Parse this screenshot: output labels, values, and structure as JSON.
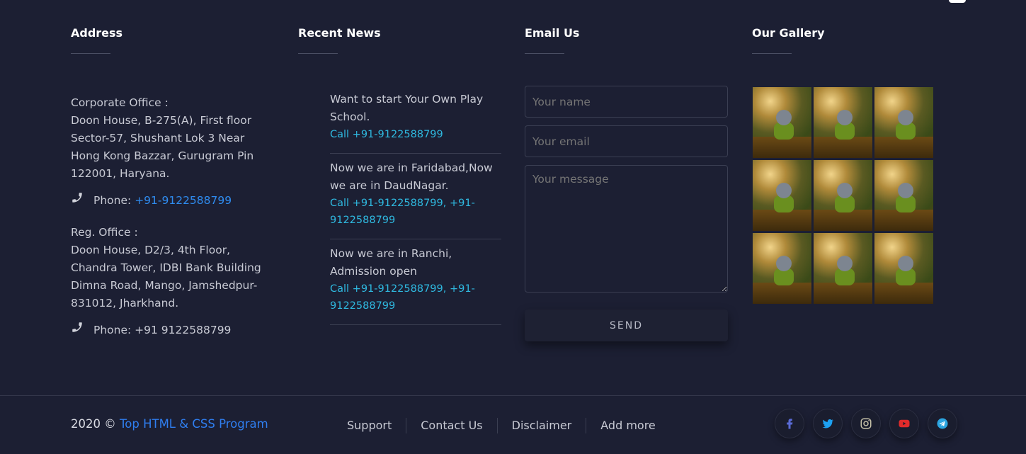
{
  "columns": {
    "address_title": "Address",
    "news_title": "Recent News",
    "email_title": "Email Us",
    "gallery_title": "Our Gallery"
  },
  "address": {
    "corporate_label": "Corporate Office :",
    "corporate_lines": [
      "Doon House, B-275(A), First floor",
      "Sector-57, Shushant Lok 3 Near",
      "Hong Kong Bazzar, Gurugram Pin",
      "122001, Haryana."
    ],
    "corporate_phone_label": "Phone:",
    "corporate_phone": "+91-9122588799",
    "reg_label": "Reg. Office :",
    "reg_lines": [
      "Doon House, D2/3, 4th Floor,",
      "Chandra Tower, IDBI Bank Building",
      "Dimna Road, Mango, Jamshedpur-",
      "831012, Jharkhand."
    ],
    "reg_phone_text": "Phone: +91 9122588799"
  },
  "news": [
    {
      "text": "Want to start Your Own Play School.",
      "call": "Call +91-9122588799"
    },
    {
      "text": "Now we are in Faridabad,Now we are in DaudNagar.",
      "call": "Call +91-9122588799, +91-9122588799"
    },
    {
      "text": "Now we are in Ranchi, Admission open",
      "call": "Call +91-9122588799, +91-9122588799"
    }
  ],
  "form": {
    "name_placeholder": "Your name",
    "email_placeholder": "Your email",
    "message_placeholder": "Your message",
    "send_label": "SEND"
  },
  "gallery": {
    "image_count": 9
  },
  "footer": {
    "copyright_prefix": "2020 ©",
    "copyright_link": "Top HTML & CSS Program",
    "links": [
      "Support",
      "Contact Us",
      "Disclaimer",
      "Add more"
    ],
    "socials": [
      {
        "name": "facebook",
        "color": "#5a6bd6"
      },
      {
        "name": "twitter",
        "color": "#1da1f2"
      },
      {
        "name": "instagram",
        "color": "#c7c2a8"
      },
      {
        "name": "youtube",
        "color": "#e02b2b"
      },
      {
        "name": "telegram",
        "color": "#2ca5e0"
      }
    ]
  }
}
